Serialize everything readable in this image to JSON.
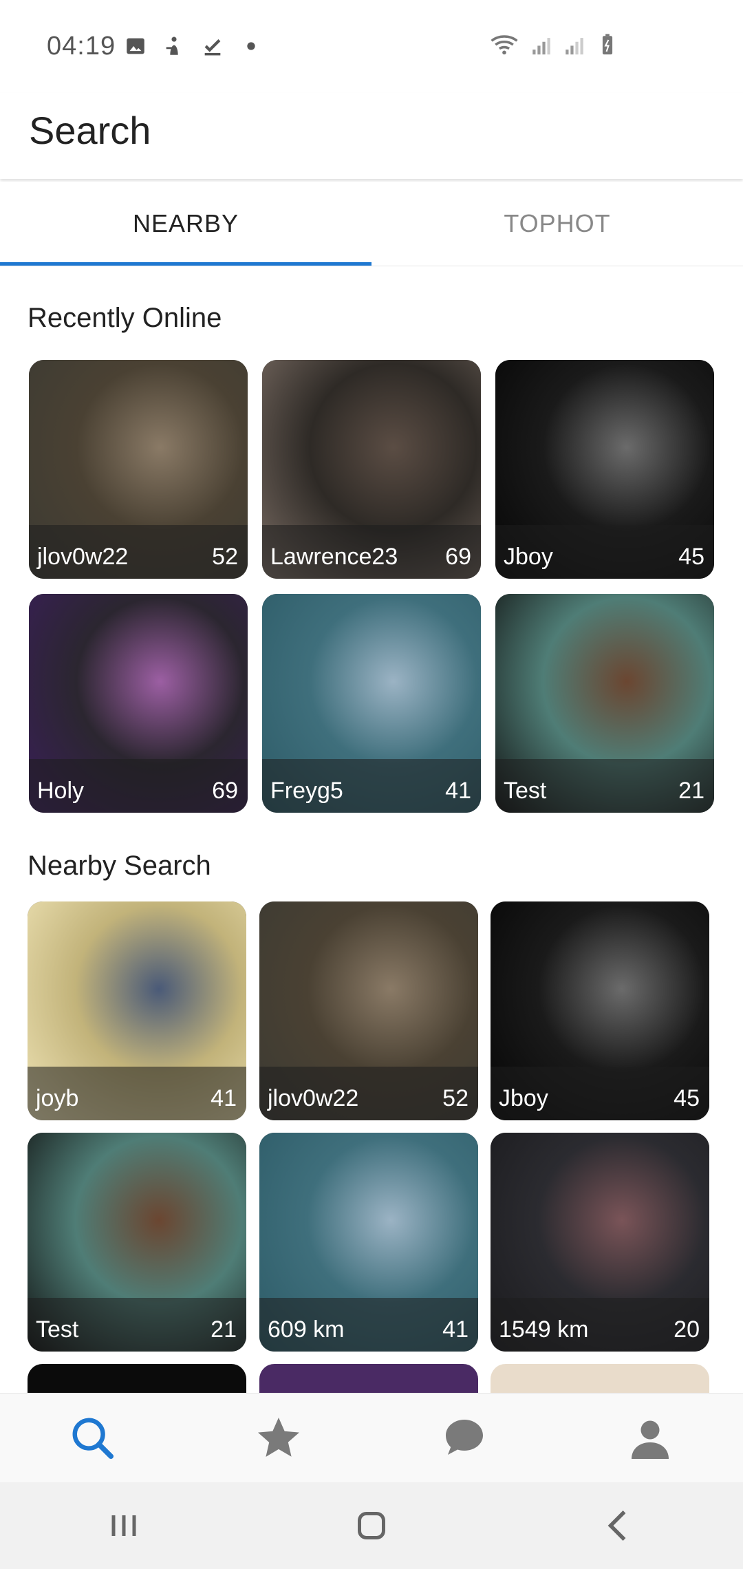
{
  "status_bar": {
    "time": "04:19",
    "left_icons": [
      "image-icon",
      "accessibility-icon",
      "check-icon",
      "dot-icon"
    ],
    "right_icons": [
      "wifi-icon",
      "signal-icon",
      "signal-roaming-icon",
      "battery-icon"
    ]
  },
  "app_bar": {
    "title": "Search"
  },
  "tabs": [
    {
      "label": "NEARBY",
      "active": true
    },
    {
      "label": "TOPHOT",
      "active": false
    }
  ],
  "recently_online": {
    "title": "Recently Online",
    "cards": [
      {
        "name": "jlov0w22",
        "age": "52",
        "colors": [
          "#3b3a33",
          "#8a7a66",
          "#4a4133"
        ]
      },
      {
        "name": "Lawrence23",
        "age": "69",
        "colors": [
          "#7d6f66",
          "#5b4d44",
          "#2e2a26"
        ]
      },
      {
        "name": "Jboy",
        "age": "45",
        "colors": [
          "#050505",
          "#6b6b6b",
          "#1a1a1a"
        ]
      },
      {
        "name": "Holy",
        "age": "69",
        "colors": [
          "#3a1e5a",
          "#9c5fa3",
          "#2b2630"
        ]
      },
      {
        "name": "Freyg5",
        "age": "41",
        "colors": [
          "#2c5a66",
          "#9bb3c4",
          "#3f6f7c"
        ]
      },
      {
        "name": "Test",
        "age": "21",
        "colors": [
          "#0f0f0f",
          "#6b4631",
          "#4f7d76"
        ]
      }
    ]
  },
  "nearby_search": {
    "title": "Nearby Search",
    "cards": [
      {
        "name": "joyb",
        "age": "41",
        "colors": [
          "#f1e6b9",
          "#4a5a78",
          "#c2b37a"
        ]
      },
      {
        "name": "jlov0w22",
        "age": "52",
        "colors": [
          "#3b3a33",
          "#8a7a66",
          "#4a4133"
        ]
      },
      {
        "name": "Jboy",
        "age": "45",
        "colors": [
          "#050505",
          "#6b6b6b",
          "#1a1a1a"
        ]
      },
      {
        "name": "Test",
        "age": "21",
        "colors": [
          "#0f0f0f",
          "#6b4631",
          "#4f7d76"
        ]
      },
      {
        "name": "609 km",
        "age": "41",
        "colors": [
          "#2c5a66",
          "#9bb3c4",
          "#3f6f7c"
        ]
      },
      {
        "name": "1549 km",
        "age": "20",
        "colors": [
          "#1a1a1d",
          "#7a5458",
          "#2b2b30"
        ]
      }
    ]
  },
  "bottom_nav": {
    "items": [
      {
        "icon": "search-icon",
        "active": true
      },
      {
        "icon": "star-icon",
        "active": false
      },
      {
        "icon": "chat-icon",
        "active": false
      },
      {
        "icon": "profile-icon",
        "active": false
      }
    ],
    "active_color": "#1f78d1",
    "inactive_color": "#7a7a7a"
  },
  "system_nav": [
    "recent-apps-icon",
    "home-icon",
    "back-icon"
  ]
}
